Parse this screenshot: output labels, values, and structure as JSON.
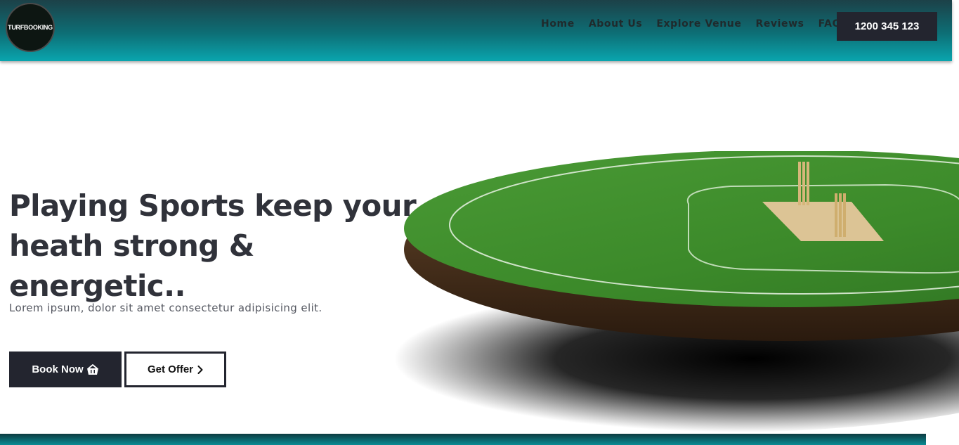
{
  "brand": {
    "logo_text": "TURFBOOKING"
  },
  "nav": {
    "links": [
      "Home",
      "About Us",
      "Explore Venue",
      "Reviews",
      "FAQ"
    ],
    "phone": "1200 345 123"
  },
  "hero": {
    "title_line1": "Playing Sports keep your",
    "title_line2": "heath strong & energetic..",
    "subtitle": "Lorem ipsum, dolor sit amet consectetur adipisicing elit.",
    "book_label": "Book Now",
    "offer_label": "Get Offer"
  },
  "icons": {
    "book": "basket-icon",
    "offer": "chevron-right-icon",
    "illustration": "cricket-field-illustration"
  },
  "colors": {
    "nav_gradient_start": "#1c4148",
    "nav_gradient_end": "#0aa5ae",
    "dark": "#23252f",
    "title": "#30323a",
    "grass": "#3d8a2c",
    "pitch": "#dcc495"
  }
}
